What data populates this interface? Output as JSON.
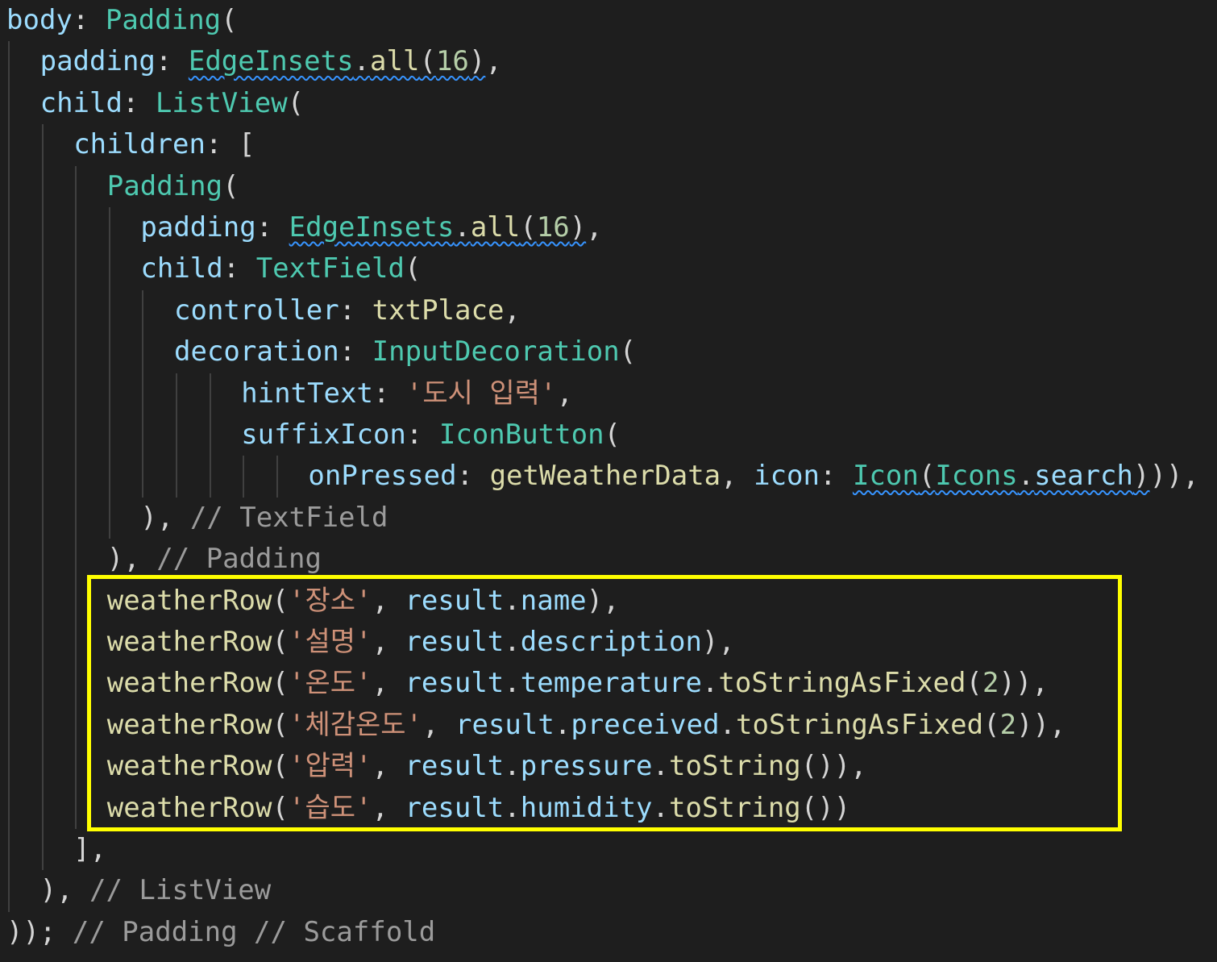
{
  "lines": [
    {
      "indent": 0,
      "tokens": [
        {
          "t": "body",
          "k": "key"
        },
        {
          "t": ": ",
          "k": "pun"
        },
        {
          "t": "Padding",
          "k": "type"
        },
        {
          "t": "(",
          "k": "pun"
        }
      ]
    },
    {
      "indent": 1,
      "tokens": [
        {
          "t": "padding",
          "k": "key"
        },
        {
          "t": ": ",
          "k": "pun"
        },
        {
          "t": "EdgeInsets",
          "k": "type",
          "squig": true
        },
        {
          "t": ".",
          "k": "pun",
          "squig": true
        },
        {
          "t": "all",
          "k": "fn",
          "squig": true
        },
        {
          "t": "(",
          "k": "pun",
          "squig": true
        },
        {
          "t": "16",
          "k": "num",
          "squig": true
        },
        {
          "t": ")",
          "k": "pun",
          "squig": true
        },
        {
          "t": ",",
          "k": "pun"
        }
      ]
    },
    {
      "indent": 1,
      "tokens": [
        {
          "t": "child",
          "k": "key"
        },
        {
          "t": ": ",
          "k": "pun"
        },
        {
          "t": "ListView",
          "k": "type"
        },
        {
          "t": "(",
          "k": "pun"
        }
      ]
    },
    {
      "indent": 2,
      "tokens": [
        {
          "t": "children",
          "k": "key"
        },
        {
          "t": ": [",
          "k": "pun"
        }
      ]
    },
    {
      "indent": 3,
      "tokens": [
        {
          "t": "Padding",
          "k": "type"
        },
        {
          "t": "(",
          "k": "pun"
        }
      ]
    },
    {
      "indent": 4,
      "tokens": [
        {
          "t": "padding",
          "k": "key"
        },
        {
          "t": ": ",
          "k": "pun"
        },
        {
          "t": "EdgeInsets",
          "k": "type",
          "squig": true
        },
        {
          "t": ".",
          "k": "pun",
          "squig": true
        },
        {
          "t": "all",
          "k": "fn",
          "squig": true
        },
        {
          "t": "(",
          "k": "pun",
          "squig": true
        },
        {
          "t": "16",
          "k": "num",
          "squig": true
        },
        {
          "t": ")",
          "k": "pun",
          "squig": true
        },
        {
          "t": ",",
          "k": "pun"
        }
      ]
    },
    {
      "indent": 4,
      "tokens": [
        {
          "t": "child",
          "k": "key"
        },
        {
          "t": ": ",
          "k": "pun"
        },
        {
          "t": "TextField",
          "k": "type"
        },
        {
          "t": "(",
          "k": "pun"
        }
      ]
    },
    {
      "indent": 5,
      "tokens": [
        {
          "t": "controller",
          "k": "key"
        },
        {
          "t": ": ",
          "k": "pun"
        },
        {
          "t": "txtPlace",
          "k": "fn"
        },
        {
          "t": ",",
          "k": "pun"
        }
      ]
    },
    {
      "indent": 5,
      "tokens": [
        {
          "t": "decoration",
          "k": "key"
        },
        {
          "t": ": ",
          "k": "pun"
        },
        {
          "t": "InputDecoration",
          "k": "type"
        },
        {
          "t": "(",
          "k": "pun"
        }
      ]
    },
    {
      "indent": 7,
      "tokens": [
        {
          "t": "hintText",
          "k": "key"
        },
        {
          "t": ": ",
          "k": "pun"
        },
        {
          "t": "'도시 입력'",
          "k": "str"
        },
        {
          "t": ",",
          "k": "pun"
        }
      ]
    },
    {
      "indent": 7,
      "tokens": [
        {
          "t": "suffixIcon",
          "k": "key"
        },
        {
          "t": ": ",
          "k": "pun"
        },
        {
          "t": "IconButton",
          "k": "type"
        },
        {
          "t": "(",
          "k": "pun"
        }
      ]
    },
    {
      "indent": 9,
      "tokens": [
        {
          "t": "onPressed",
          "k": "key"
        },
        {
          "t": ": ",
          "k": "pun"
        },
        {
          "t": "getWeatherData",
          "k": "fn"
        },
        {
          "t": ", ",
          "k": "pun"
        },
        {
          "t": "icon",
          "k": "key"
        },
        {
          "t": ": ",
          "k": "pun"
        },
        {
          "t": "Icon",
          "k": "type",
          "squig": true
        },
        {
          "t": "(",
          "k": "pun",
          "squig": true
        },
        {
          "t": "Icons",
          "k": "type",
          "squig": true
        },
        {
          "t": ".",
          "k": "pun",
          "squig": true
        },
        {
          "t": "search",
          "k": "key",
          "squig": true
        },
        {
          "t": ")",
          "k": "pun",
          "squig": true
        },
        {
          "t": ")),",
          "k": "pun"
        }
      ]
    },
    {
      "indent": 4,
      "tokens": [
        {
          "t": "), ",
          "k": "pun"
        },
        {
          "t": "// TextField",
          "k": "cmt"
        }
      ]
    },
    {
      "indent": 3,
      "tokens": [
        {
          "t": "), ",
          "k": "pun"
        },
        {
          "t": "// Padding",
          "k": "cmt"
        }
      ]
    },
    {
      "indent": 3,
      "tokens": [
        {
          "t": "weatherRow",
          "k": "fn"
        },
        {
          "t": "(",
          "k": "pun"
        },
        {
          "t": "'장소'",
          "k": "str"
        },
        {
          "t": ", ",
          "k": "pun"
        },
        {
          "t": "result",
          "k": "key"
        },
        {
          "t": ".",
          "k": "pun"
        },
        {
          "t": "name",
          "k": "key"
        },
        {
          "t": "),",
          "k": "pun"
        }
      ]
    },
    {
      "indent": 3,
      "tokens": [
        {
          "t": "weatherRow",
          "k": "fn"
        },
        {
          "t": "(",
          "k": "pun"
        },
        {
          "t": "'설명'",
          "k": "str"
        },
        {
          "t": ", ",
          "k": "pun"
        },
        {
          "t": "result",
          "k": "key"
        },
        {
          "t": ".",
          "k": "pun"
        },
        {
          "t": "description",
          "k": "key"
        },
        {
          "t": "),",
          "k": "pun"
        }
      ]
    },
    {
      "indent": 3,
      "tokens": [
        {
          "t": "weatherRow",
          "k": "fn"
        },
        {
          "t": "(",
          "k": "pun"
        },
        {
          "t": "'온도'",
          "k": "str"
        },
        {
          "t": ", ",
          "k": "pun"
        },
        {
          "t": "result",
          "k": "key"
        },
        {
          "t": ".",
          "k": "pun"
        },
        {
          "t": "temperature",
          "k": "key"
        },
        {
          "t": ".",
          "k": "pun"
        },
        {
          "t": "toStringAsFixed",
          "k": "fn"
        },
        {
          "t": "(",
          "k": "pun"
        },
        {
          "t": "2",
          "k": "num"
        },
        {
          "t": ")),",
          "k": "pun"
        }
      ]
    },
    {
      "indent": 3,
      "tokens": [
        {
          "t": "weatherRow",
          "k": "fn"
        },
        {
          "t": "(",
          "k": "pun"
        },
        {
          "t": "'체감온도'",
          "k": "str"
        },
        {
          "t": ", ",
          "k": "pun"
        },
        {
          "t": "result",
          "k": "key"
        },
        {
          "t": ".",
          "k": "pun"
        },
        {
          "t": "preceived",
          "k": "key"
        },
        {
          "t": ".",
          "k": "pun"
        },
        {
          "t": "toStringAsFixed",
          "k": "fn"
        },
        {
          "t": "(",
          "k": "pun"
        },
        {
          "t": "2",
          "k": "num"
        },
        {
          "t": ")),",
          "k": "pun"
        }
      ]
    },
    {
      "indent": 3,
      "tokens": [
        {
          "t": "weatherRow",
          "k": "fn"
        },
        {
          "t": "(",
          "k": "pun"
        },
        {
          "t": "'압력'",
          "k": "str"
        },
        {
          "t": ", ",
          "k": "pun"
        },
        {
          "t": "result",
          "k": "key"
        },
        {
          "t": ".",
          "k": "pun"
        },
        {
          "t": "pressure",
          "k": "key"
        },
        {
          "t": ".",
          "k": "pun"
        },
        {
          "t": "toString",
          "k": "fn"
        },
        {
          "t": "()),",
          "k": "pun"
        }
      ]
    },
    {
      "indent": 3,
      "tokens": [
        {
          "t": "weatherRow",
          "k": "fn"
        },
        {
          "t": "(",
          "k": "pun"
        },
        {
          "t": "'습도'",
          "k": "str"
        },
        {
          "t": ", ",
          "k": "pun"
        },
        {
          "t": "result",
          "k": "key"
        },
        {
          "t": ".",
          "k": "pun"
        },
        {
          "t": "humidity",
          "k": "key"
        },
        {
          "t": ".",
          "k": "pun"
        },
        {
          "t": "toString",
          "k": "fn"
        },
        {
          "t": "())",
          "k": "pun"
        }
      ]
    },
    {
      "indent": 2,
      "tokens": [
        {
          "t": "],",
          "k": "pun"
        }
      ]
    },
    {
      "indent": 1,
      "tokens": [
        {
          "t": "), ",
          "k": "pun"
        },
        {
          "t": "// ListView",
          "k": "cmt"
        }
      ]
    },
    {
      "indent": 0,
      "tokens": [
        {
          "t": ")); ",
          "k": "pun"
        },
        {
          "t": "// Padding // Scaffold",
          "k": "cmt"
        }
      ]
    }
  ],
  "colors": {
    "background": "#1e1e1e",
    "key": "#9cdcfe",
    "type": "#4ec9b0",
    "fn": "#dcdcaa",
    "num": "#b5cea8",
    "str": "#ce9178",
    "cmt": "#9b9b9b",
    "pun": "#d4d4d4",
    "highlight": "#ffff00",
    "squiggle": "#3794ff"
  }
}
